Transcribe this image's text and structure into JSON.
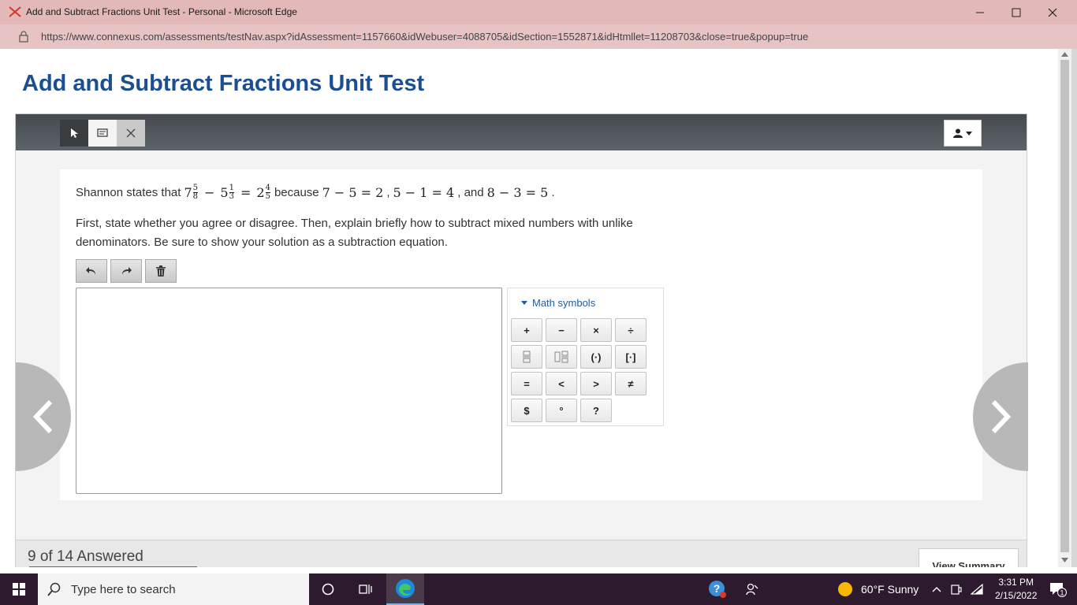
{
  "browser": {
    "title": "Add and Subtract Fractions Unit Test - Personal - Microsoft Edge",
    "url": "https://www.connexus.com/assessments/testNav.aspx?idAssessment=1157660&idWebuser=4088705&idSection=1552871&idHtmllet=11208703&close=true&popup=true"
  },
  "page": {
    "title": "Add and Subtract Fractions Unit Test"
  },
  "question": {
    "prefix": "Shannon states that",
    "whole1": "7",
    "num1": "5",
    "den1": "8",
    "minus": "−",
    "whole2": "5",
    "num2": "1",
    "den2": "3",
    "equals": "=",
    "whole3": "2",
    "num3": "4",
    "den3": "5",
    "because": "because",
    "eq1": "7 − 5 = 2",
    "sep1": ",",
    "eq2": "5 − 1 = 4",
    "and": ", and",
    "eq3": "8 − 3 = 5",
    "period": ".",
    "instructions": "First, state whether you agree or disagree. Then, explain briefly how to subtract mixed numbers with unlike denominators. Be sure to show your solution as a subtraction equation."
  },
  "math_panel": {
    "header": "Math symbols",
    "symbols": [
      "+",
      "−",
      "×",
      "÷",
      "",
      "",
      "(·)",
      "[·]",
      "=",
      "<",
      ">",
      "≠",
      "$",
      "°",
      "?"
    ]
  },
  "footer": {
    "answered": "9 of 14 Answered",
    "answered_count": 9,
    "total_count": 14,
    "view_summary": "View Summary"
  },
  "taskbar": {
    "search_placeholder": "Type here to search",
    "weather": "60°F  Sunny",
    "time": "3:31 PM",
    "date": "2/15/2022",
    "notification_count": "1"
  },
  "colors": {
    "title_blue": "#1c4f91",
    "link_blue": "#1f5c9b",
    "titlebar_pink": "#e2b8b8",
    "taskbar": "#2e1a2e"
  }
}
